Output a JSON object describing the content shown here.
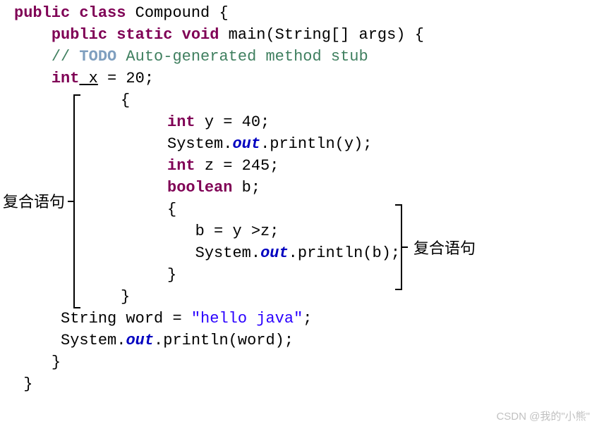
{
  "code": {
    "l1_kw1": "public",
    "l1_kw2": "class",
    "l1_name": " Compound {",
    "l2_indent": "    ",
    "l2_kw1": "public",
    "l2_kw2": "static",
    "l2_kw3": "void",
    "l2_rest": " main(String[] args) {",
    "l3_indent": "    ",
    "l3_comment_slash": "// ",
    "l3_todo": "TODO",
    "l3_comment_rest": " Auto-generated method stub",
    "l4_indent": "    ",
    "l4_kw": "int",
    "l4_var": " x",
    "l4_rest": " = 20;",
    "l5_indent": "     ",
    "l5_brace": "{",
    "l6_indent": "          ",
    "l6_kw": "int",
    "l6_rest": " y = 40;",
    "l7_indent": "          ",
    "l7_sys": "System.",
    "l7_out": "out",
    "l7_rest": ".println(y);",
    "l8_indent": "          ",
    "l8_kw": "int",
    "l8_rest": " z = 245;",
    "l9_indent": "          ",
    "l9_kw": "boolean",
    "l9_rest": " b;",
    "l10_indent": "          ",
    "l10_brace": "{",
    "l11_indent": "             ",
    "l11_rest": "b = y >z;",
    "l12_indent": "             ",
    "l12_sys": "System.",
    "l12_out": "out",
    "l12_rest": ".println(b);",
    "l13_indent": "          ",
    "l13_brace": "}",
    "l14_indent": "     ",
    "l14_brace": "}",
    "l15_indent": "     ",
    "l15_decl": "String word = ",
    "l15_str": "\"hello java\"",
    "l15_semi": ";",
    "l16_indent": "     ",
    "l16_sys": "System.",
    "l16_out": "out",
    "l16_rest": ".println(word);",
    "l17_indent": "    ",
    "l17_brace": "}",
    "l18_indent": " ",
    "l18_brace": "}"
  },
  "annotations": {
    "left_label": "复合语句",
    "right_label": "复合语句"
  },
  "watermark": "CSDN @我的\"小熊\""
}
